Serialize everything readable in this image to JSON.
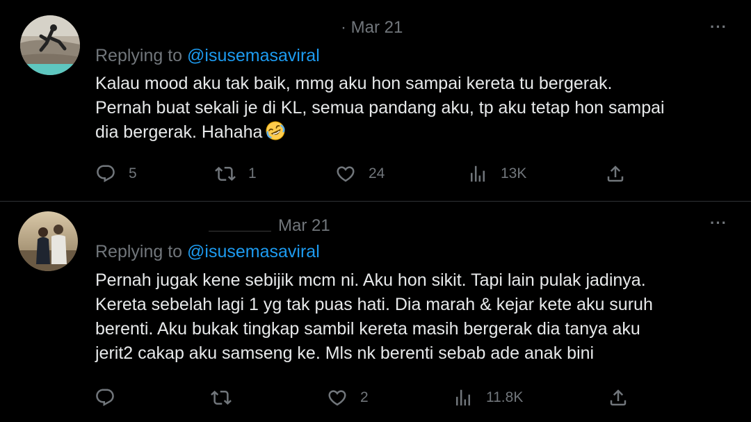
{
  "tweets": [
    {
      "date": "· Mar 21",
      "more_label": "···",
      "replying_prefix": "Replying to",
      "replying_handle": "@isusemasaviral",
      "text_lines": [
        "Kalau mood aku tak baik, mmg aku hon sampai kereta tu bergerak.",
        "Pernah buat sekali je di KL, semua pandang aku, tp aku tetap hon sampai",
        "dia bergerak. Hahaha"
      ],
      "emoji": "rolling-on-floor-laughing-emoji",
      "actions": {
        "replies": "5",
        "retweets": "1",
        "likes": "24",
        "views": "13K"
      }
    },
    {
      "date": "Mar 21",
      "more_label": "···",
      "replying_prefix": "Replying to",
      "replying_handle": "@isusemasaviral",
      "text_lines": [
        "Pernah jugak kene sebijik mcm ni. Aku hon sikit. Tapi lain pulak jadinya.",
        "Kereta sebelah lagi 1 yg tak puas hati. Dia marah & kejar kete aku suruh",
        "berenti. Aku bukak tingkap sambil kereta masih bergerak dia tanya aku",
        "jerit2 cakap aku samseng ke. Mls nk berenti sebab ade anak bini"
      ],
      "actions": {
        "replies": "",
        "retweets": "",
        "likes": "2",
        "views": "11.8K"
      }
    }
  ],
  "colors": {
    "background": "#000000",
    "text": "#e7e9ea",
    "muted": "#71767b",
    "link": "#1d9bf0"
  },
  "icons": [
    "reply-icon",
    "retweet-icon",
    "like-icon",
    "views-icon",
    "share-icon",
    "more-icon"
  ]
}
